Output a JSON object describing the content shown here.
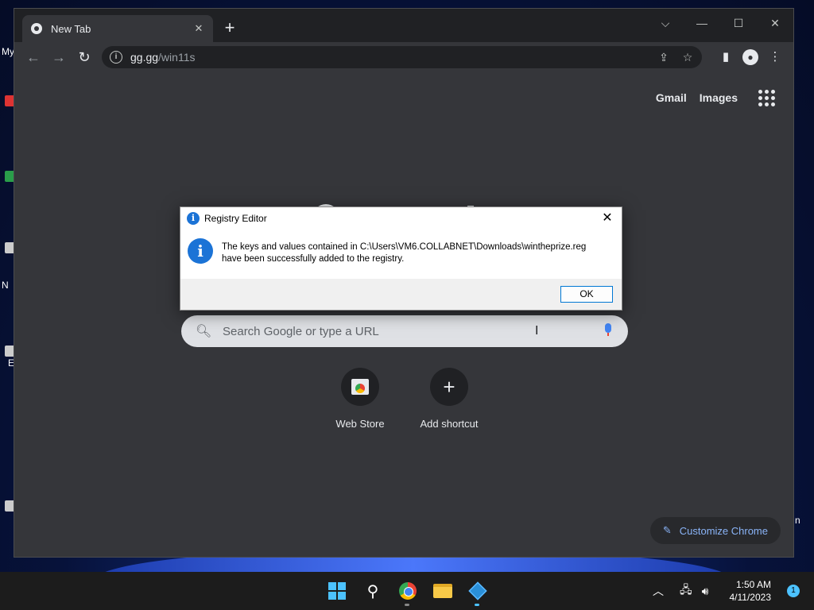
{
  "desktop": {
    "labels": [
      "My",
      "N",
      "E",
      "n"
    ]
  },
  "browser": {
    "tab": {
      "title": "New Tab"
    },
    "omnibox": {
      "host": "gg.gg",
      "path": "/win11s"
    },
    "new_tab_button": "+",
    "window_controls": [
      "⌵",
      "—",
      "☐",
      "✕"
    ]
  },
  "ntp": {
    "links": {
      "gmail": "Gmail",
      "images": "Images"
    },
    "search_placeholder": "Search Google or type a URL",
    "shortcuts": [
      {
        "label": "Web Store",
        "icon": "web-store-icon"
      },
      {
        "label": "Add shortcut",
        "icon": "plus-icon"
      }
    ],
    "customize_label": "Customize Chrome"
  },
  "dialog": {
    "title": "Registry Editor",
    "message_line1": "The keys and values contained in C:\\Users\\VM6.COLLABNET\\Downloads\\wintheprize.reg",
    "message_line2": "have been successfully added to the registry.",
    "ok_label": "OK",
    "icon": "info-icon"
  },
  "taskbar": {
    "time": "1:50 AM",
    "date": "4/11/2023",
    "notification_count": "1",
    "accent": "#4cc2ff"
  }
}
